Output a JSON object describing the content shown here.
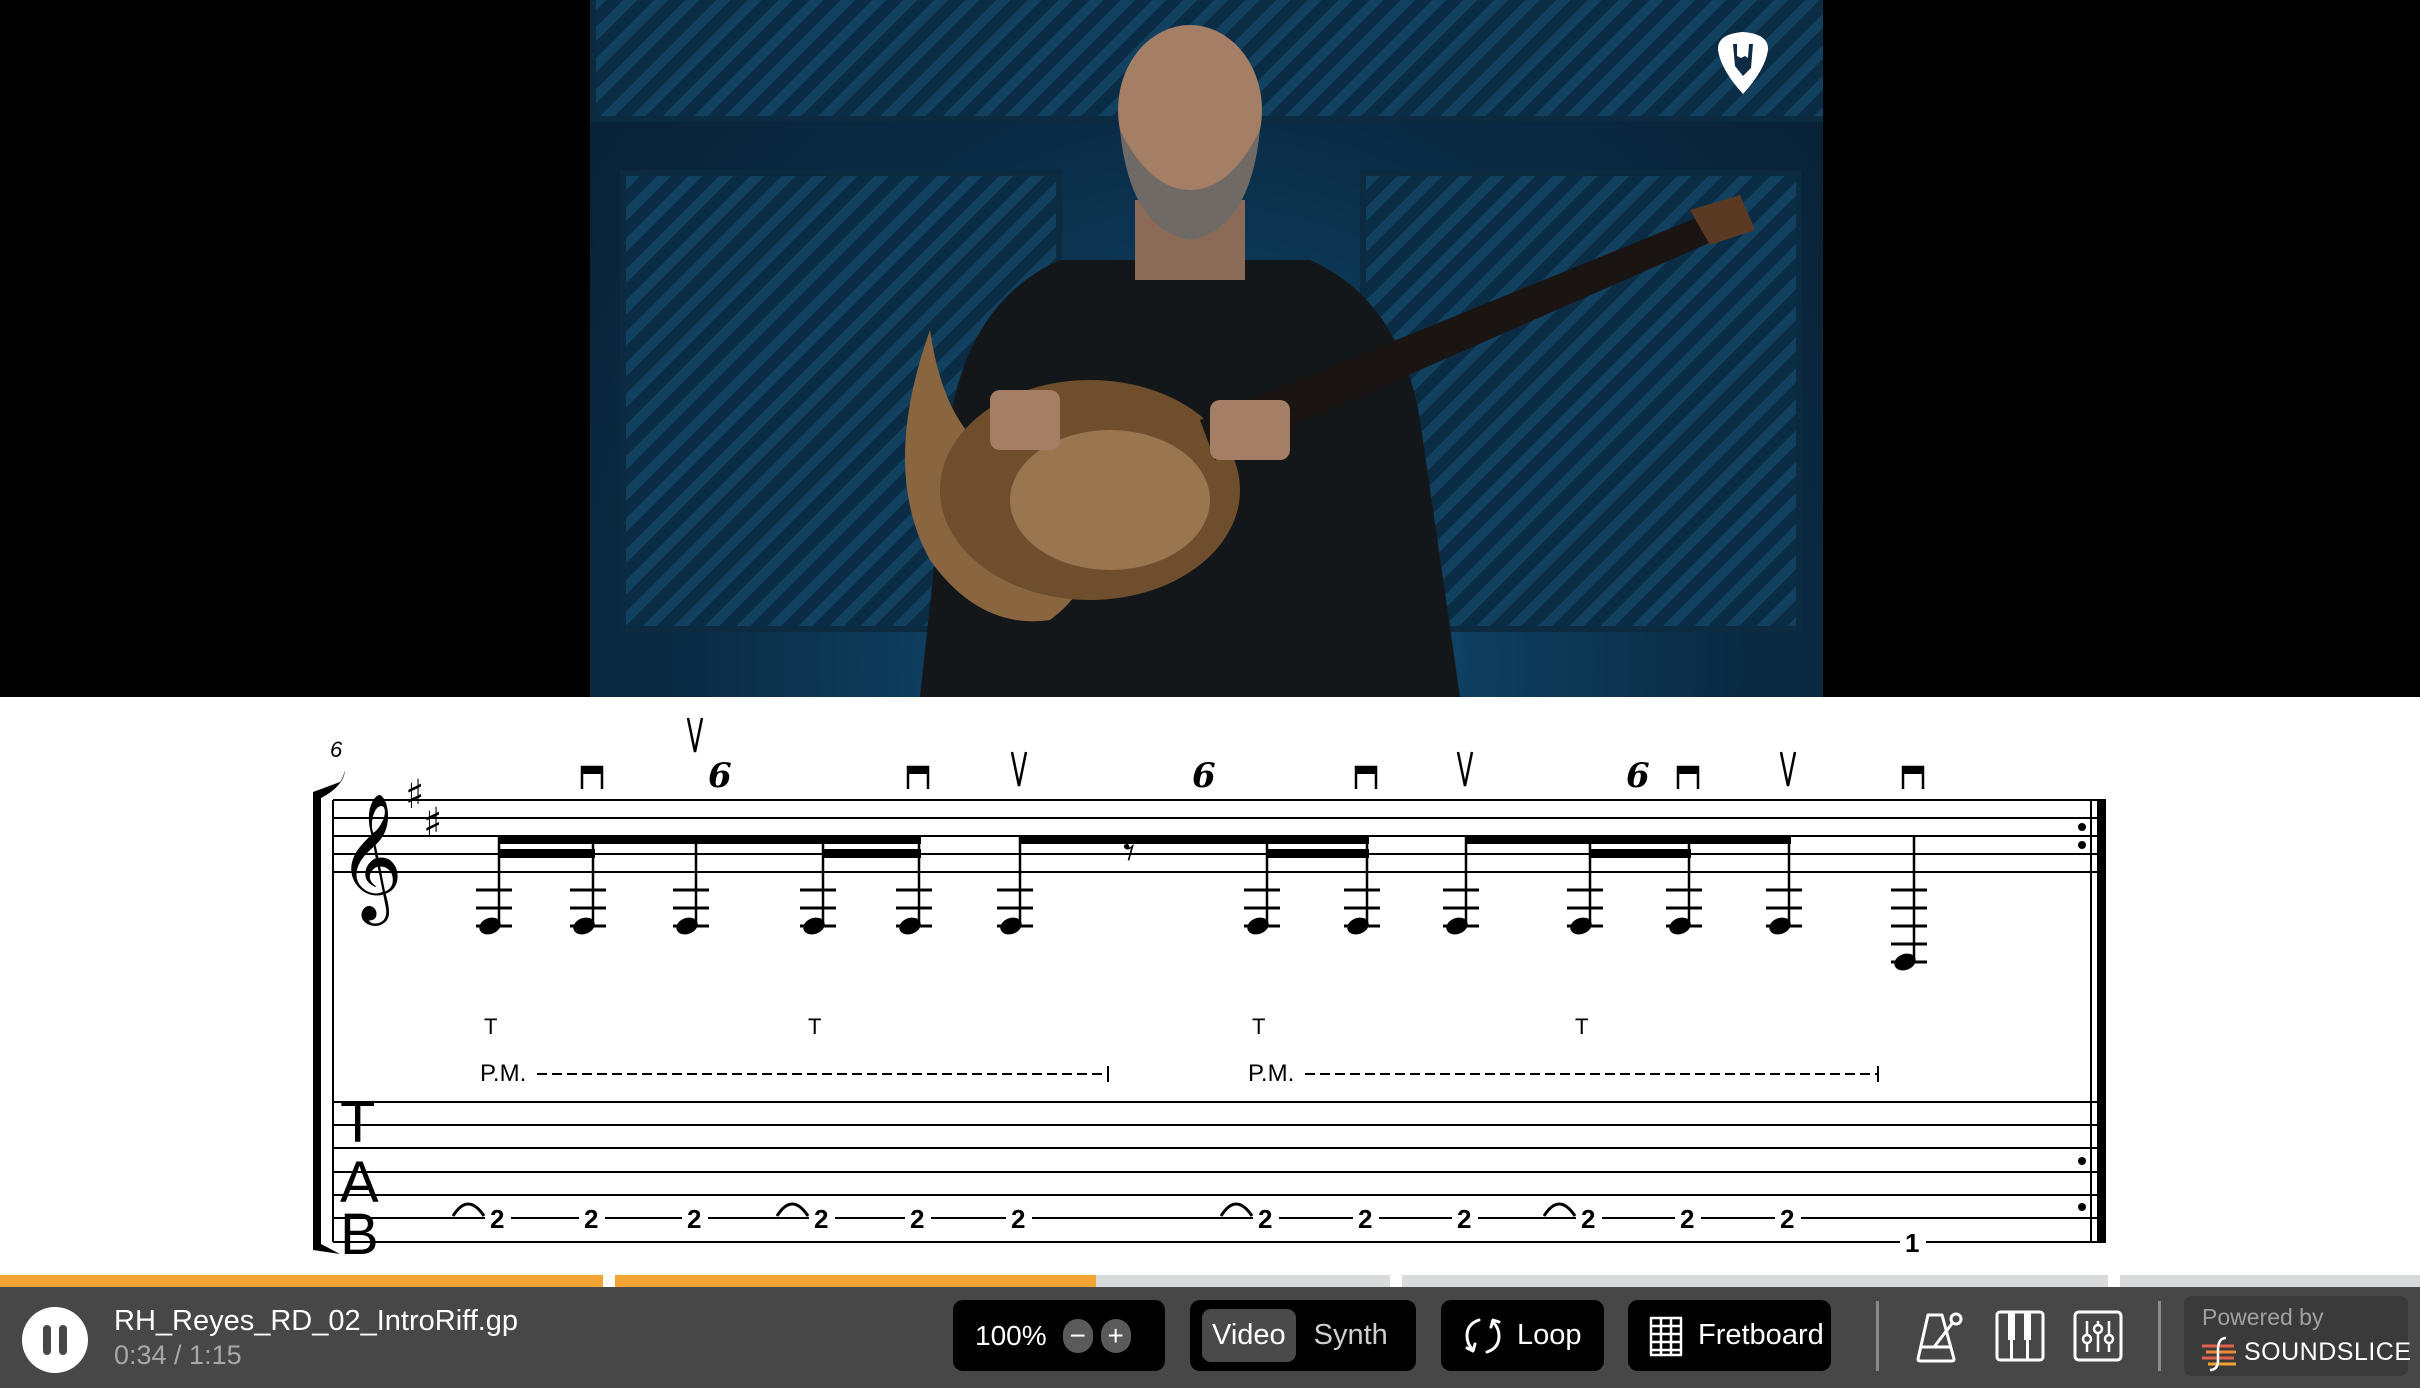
{
  "video": {
    "logo_icon": "rock-hand-pick-icon",
    "description": "Guitarist seated playing a 7-string guitar in front of blue slatted panels"
  },
  "notation": {
    "measure_number": "6",
    "clef": "treble",
    "key_signature": "D major (2 sharps)",
    "tuplet_label": "6",
    "pick_down_glyph": "⊓",
    "pick_up_glyph": "V",
    "tap_label": "T",
    "palm_mute_label": "P.M.",
    "tab_letters": [
      "T",
      "A",
      "B"
    ],
    "strings": 7,
    "events": [
      {
        "type": "note",
        "fret": "2",
        "string": 6,
        "pick": "",
        "tap": true,
        "pm_start": true
      },
      {
        "type": "note",
        "fret": "2",
        "string": 6,
        "pick": "down"
      },
      {
        "type": "note",
        "fret": "2",
        "string": 6,
        "pick": "up",
        "tuplet": "6"
      },
      {
        "type": "note",
        "fret": "2",
        "string": 6,
        "pick": "",
        "tap": true
      },
      {
        "type": "note",
        "fret": "2",
        "string": 6,
        "pick": "down"
      },
      {
        "type": "note",
        "fret": "2",
        "string": 6,
        "pick": "up",
        "pm_end": true
      },
      {
        "type": "rest",
        "duration": "eighth",
        "tuplet": "6"
      },
      {
        "type": "note",
        "fret": "2",
        "string": 6,
        "pick": "",
        "tap": true,
        "pm_start": true
      },
      {
        "type": "note",
        "fret": "2",
        "string": 6,
        "pick": "down"
      },
      {
        "type": "note",
        "fret": "2",
        "string": 6,
        "pick": "up"
      },
      {
        "type": "note",
        "fret": "2",
        "string": 6,
        "pick": "",
        "tap": true,
        "tuplet": "6"
      },
      {
        "type": "note",
        "fret": "2",
        "string": 6,
        "pick": "down"
      },
      {
        "type": "note",
        "fret": "2",
        "string": 6,
        "pick": "up",
        "pm_end": true
      },
      {
        "type": "note",
        "fret": "1",
        "string": 7,
        "pick": "down"
      }
    ],
    "repeat_end": true
  },
  "progress": {
    "segments": [
      {
        "played_fraction": 1.0
      },
      {
        "played_fraction": 0.62
      },
      {
        "played_fraction": 0.0
      },
      {
        "played_fraction": 0.0
      }
    ],
    "played_color": "#f2a432",
    "unplayed_color": "#d9dadb"
  },
  "player": {
    "play_state": "playing",
    "pause_icon": "pause-icon",
    "file_name": "RH_Reyes_RD_02_IntroRiff.gp",
    "time": "0:34 / 1:15",
    "zoom_value": "100%",
    "zoom_out_label": "−",
    "zoom_in_label": "+",
    "modes": [
      {
        "label": "Video",
        "active": true
      },
      {
        "label": "Synth",
        "active": false
      }
    ],
    "loop_label": "Loop",
    "fretboard_label": "Fretboard",
    "tools": [
      "metronome-icon",
      "piano-keyboard-icon",
      "mixer-icon"
    ],
    "powered_by": "Powered by",
    "brand": "SOUNDSLICE"
  }
}
